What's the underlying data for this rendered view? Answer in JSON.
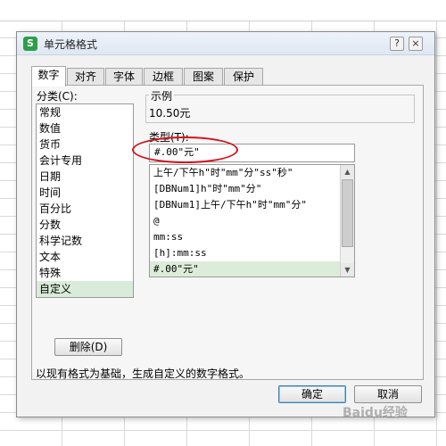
{
  "dialog": {
    "title": "单元格格式",
    "app_icon_glyph": "S",
    "help_glyph": "?",
    "close_glyph": "×"
  },
  "tabs": [
    {
      "label": "数字",
      "active": true
    },
    {
      "label": "对齐"
    },
    {
      "label": "字体"
    },
    {
      "label": "边框"
    },
    {
      "label": "图案"
    },
    {
      "label": "保护"
    }
  ],
  "category": {
    "label": "分类(C):",
    "items": [
      "常规",
      "数值",
      "货币",
      "会计专用",
      "日期",
      "时间",
      "百分比",
      "分数",
      "科学记数",
      "文本",
      "特殊",
      "自定义"
    ],
    "selected": "自定义"
  },
  "sample": {
    "label": "示例",
    "value": "10.50元"
  },
  "type": {
    "label": "类型(T):",
    "value": "#.00\"元\"",
    "list": [
      "上午/下午h\"时\"mm\"分\"ss\"秒\"",
      "[DBNum1]h\"时\"mm\"分\"",
      "[DBNum1]上午/下午h\"时\"mm\"分\"",
      "@",
      "mm:ss",
      "[h]:mm:ss",
      "#.00\"元\""
    ],
    "selected": "#.00\"元\""
  },
  "delete_button": "删除(D)",
  "description": "以现有格式为基础，生成自定义的数字格式。",
  "ok_button": "确定",
  "cancel_button": "取消",
  "watermark": "Baidu经验",
  "colors": {
    "annotation": "#d4111b",
    "selection": "#d9ecd9",
    "app_icon": "#2e9e49"
  }
}
